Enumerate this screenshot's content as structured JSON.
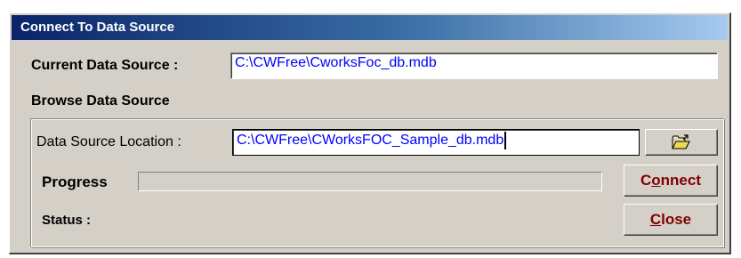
{
  "window": {
    "title": "Connect To Data Source"
  },
  "current_source": {
    "label": "Current Data Source :",
    "value": "C:\\CWFree\\CworksFoc_db.mdb"
  },
  "browse": {
    "heading": "Browse Data Source",
    "location_label": "Data Source Location :",
    "location_value": "C:\\CWFree\\CWorksFOC_Sample_db.mdb",
    "browse_icon": "open-folder-icon"
  },
  "progress": {
    "label": "Progress",
    "value": 0
  },
  "status": {
    "label": "Status :",
    "value": ""
  },
  "buttons": {
    "connect": {
      "mnemonic": "",
      "underlined": "o",
      "rest": "nnect",
      "prefix": "C"
    },
    "close": {
      "prefix": "",
      "underlined": "C",
      "rest": "lose"
    }
  }
}
